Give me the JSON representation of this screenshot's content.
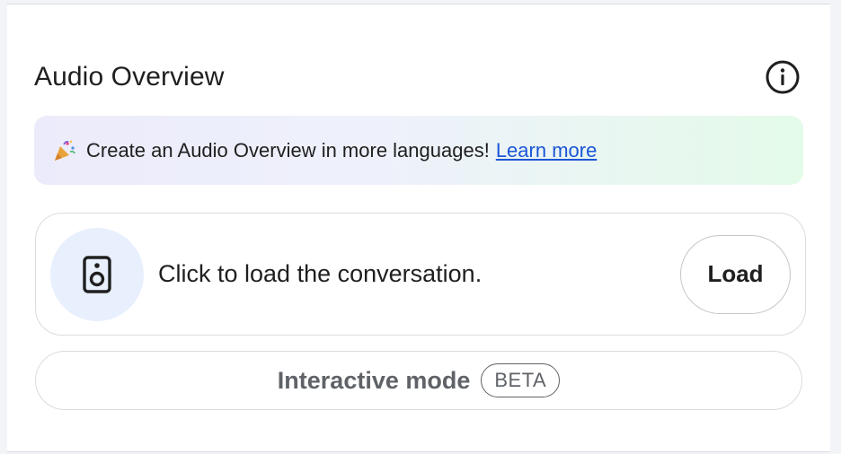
{
  "header": {
    "title": "Audio Overview",
    "info_icon": "info-circle-icon"
  },
  "banner": {
    "icon": "party-popper-icon",
    "text": "Create an Audio Overview in more languages!",
    "link_label": "Learn more"
  },
  "conversation_card": {
    "icon": "speaker-icon",
    "text": "Click to load the conversation.",
    "load_label": "Load"
  },
  "interactive_mode": {
    "label": "Interactive mode",
    "badge": "BETA"
  },
  "colors": {
    "link": "#1a56d6",
    "speaker_bg": "#e8effd",
    "muted_text": "#5f6368"
  }
}
